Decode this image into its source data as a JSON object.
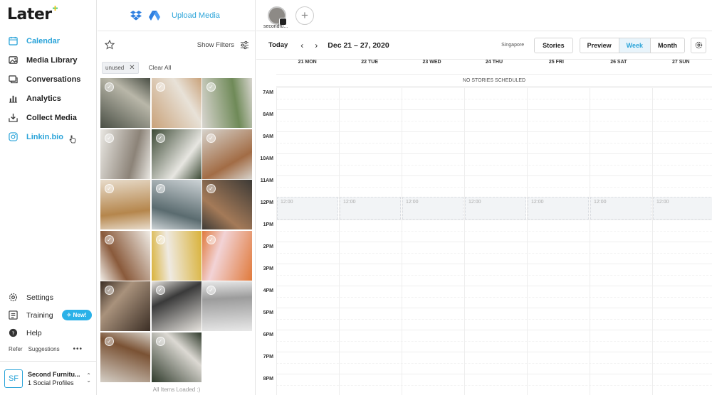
{
  "brand": {
    "name": "Later",
    "accent": "#2ba4d9"
  },
  "sidebar": {
    "items": [
      {
        "label": "Calendar",
        "icon": "calendar-icon",
        "active": true
      },
      {
        "label": "Media Library",
        "icon": "image-icon",
        "active": false
      },
      {
        "label": "Conversations",
        "icon": "chat-icon",
        "active": false
      },
      {
        "label": "Analytics",
        "icon": "bar-chart-icon",
        "active": false
      },
      {
        "label": "Collect Media",
        "icon": "download-icon",
        "active": false
      },
      {
        "label": "Linkin.bio",
        "icon": "link-icon",
        "active": true
      }
    ],
    "bottom": {
      "settings": "Settings",
      "training": "Training",
      "training_badge": "New!",
      "help": "Help",
      "refer": "Refer",
      "suggestions": "Suggestions",
      "more": "•••"
    },
    "profile": {
      "initials": "SF",
      "name": "Second Furnitu...",
      "sub": "1 Social Profiles"
    }
  },
  "media": {
    "upload_label": "Upload Media",
    "show_filters": "Show Filters",
    "tag": "unused",
    "clear_all": "Clear All",
    "footer": "All Items Loaded :)",
    "thumbnails": 17
  },
  "calendar": {
    "profile_label": "secondfu...",
    "today": "Today",
    "range": "Dec 21 – 27, 2020",
    "timezone": "Singapore",
    "stories": "Stories",
    "views": [
      "Preview",
      "Week",
      "Month"
    ],
    "active_view": "Week",
    "days": [
      "21 MON",
      "22 TUE",
      "23 WED",
      "24 THU",
      "25 FRI",
      "26 SAT",
      "27 SUN"
    ],
    "no_stories": "NO STORIES SCHEDULED",
    "hours": [
      "7AM",
      "8AM",
      "9AM",
      "10AM",
      "11AM",
      "12PM",
      "1PM",
      "2PM",
      "3PM",
      "4PM",
      "5PM",
      "6PM",
      "7PM",
      "8PM"
    ],
    "slot_label": "12:00"
  }
}
